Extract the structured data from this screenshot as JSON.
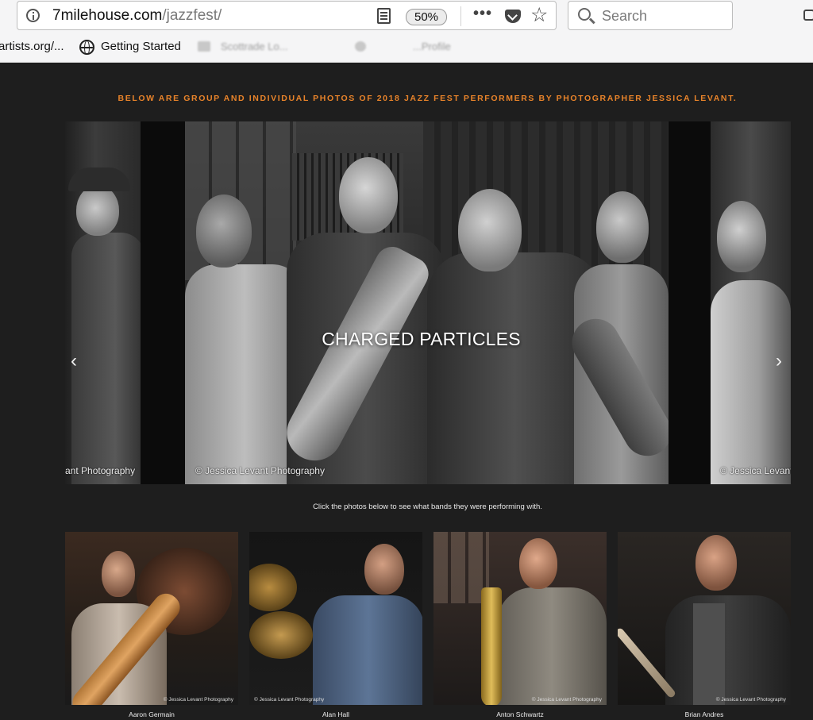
{
  "browser": {
    "url_domain": "7milehouse.com",
    "url_path": "/jazzfest/",
    "zoom": "50%",
    "more_glyph": "•••",
    "search_placeholder": "Search",
    "bookmarks": [
      {
        "label": "artists.org/..."
      },
      {
        "label": "Getting Started"
      },
      {
        "label": "Scottrade Lo..."
      },
      {
        "label": "...Profile"
      }
    ],
    "icons": [
      "info-icon",
      "reader-view-icon",
      "more-icon",
      "pocket-icon",
      "star-icon",
      "search-icon",
      "globe-icon"
    ]
  },
  "page": {
    "intro": "BELOW ARE GROUP AND INDIVIDUAL PHOTOS OF 2018 JAZZ FEST PERFORMERS BY PHOTOGRAPHER JESSICA LEVANT.",
    "slider": {
      "current_caption": "CHARGED PARTICLES",
      "watermark_left": "ant Photography",
      "watermark_center": "© Jessica Levant Photography",
      "watermark_right": "© Jessica Levant P",
      "prev_glyph": "‹",
      "next_glyph": "›"
    },
    "click_note": "Click the photos below to see what bands they were performing with.",
    "performers": [
      {
        "name": "Aaron Germain",
        "watermark": "© Jessica Levant Photography"
      },
      {
        "name": "Alan Hall",
        "watermark": "© Jessica Levant Photography"
      },
      {
        "name": "Anton Schwartz",
        "watermark": "© Jessica Levant Photography"
      },
      {
        "name": "Brian Andres",
        "watermark": "© Jessica Levant Photography"
      }
    ]
  }
}
